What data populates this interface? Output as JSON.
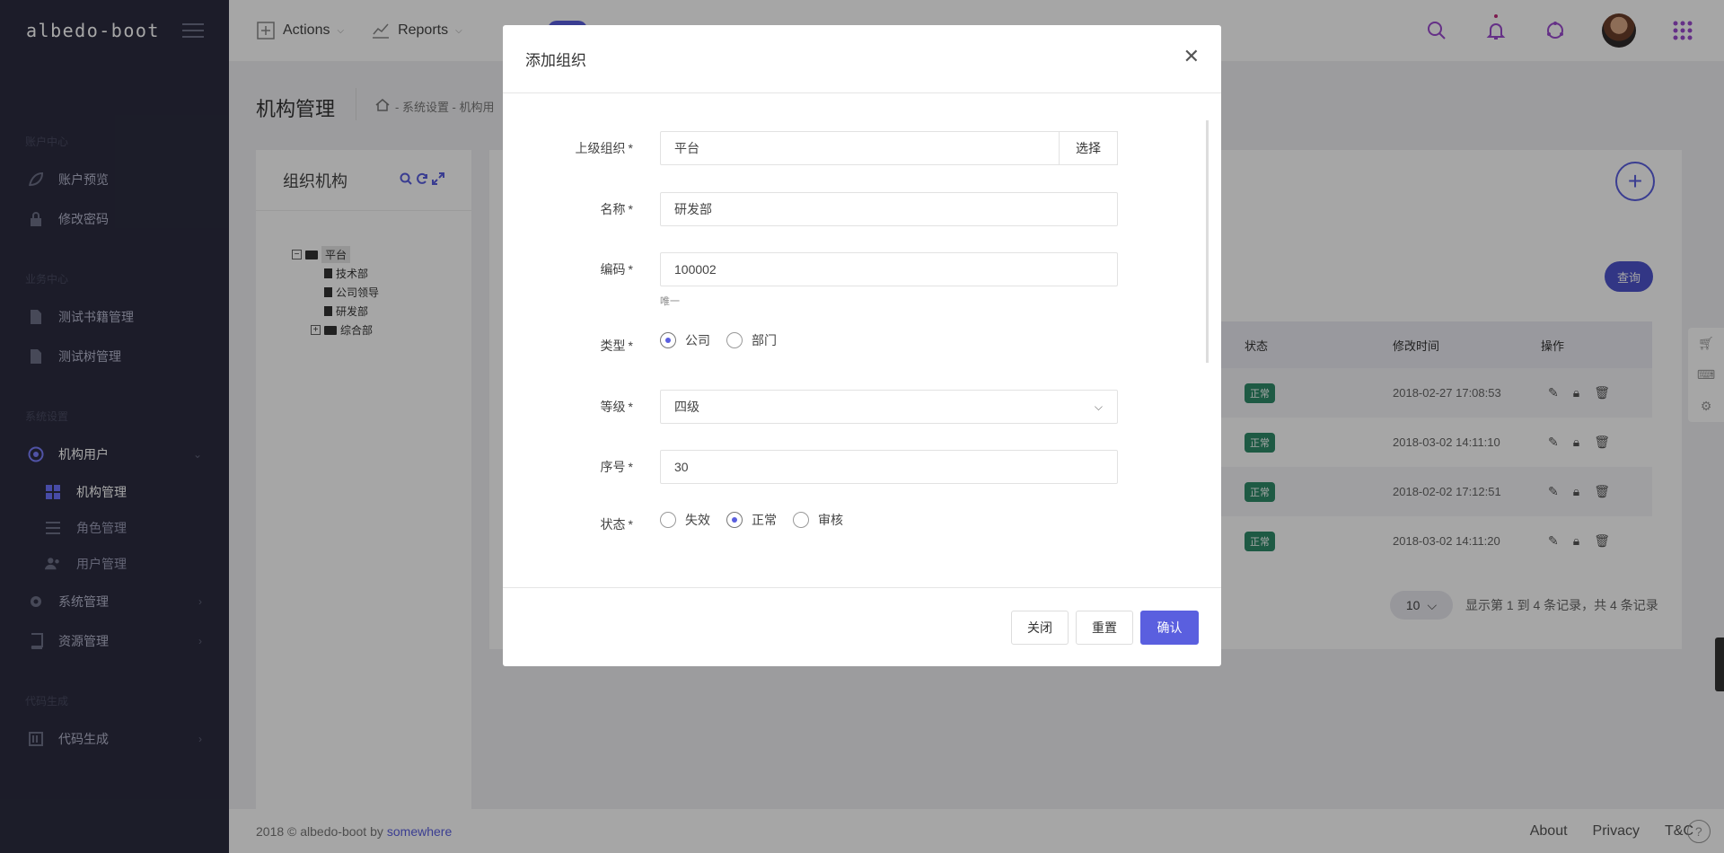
{
  "brand": "albedo-boot",
  "sidebar": {
    "sections": [
      "账户中心",
      "业务中心",
      "系统设置",
      "代码生成"
    ],
    "account_items": [
      {
        "label": "账户预览",
        "icon": "leaf-icon"
      },
      {
        "label": "修改密码",
        "icon": "lock-icon"
      }
    ],
    "business_items": [
      {
        "label": "测试书籍管理",
        "icon": "file-icon"
      },
      {
        "label": "测试树管理",
        "icon": "file-icon"
      }
    ],
    "system_items": [
      {
        "label": "机构用户",
        "icon": "target-icon"
      },
      {
        "label": "系统管理",
        "icon": "gear-icon"
      },
      {
        "label": "资源管理",
        "icon": "book-icon"
      }
    ],
    "sub_items": [
      {
        "label": "机构管理",
        "icon": "grid-icon"
      },
      {
        "label": "角色管理",
        "icon": "list-icon"
      },
      {
        "label": "用户管理",
        "icon": "users-icon"
      }
    ],
    "code_items": [
      {
        "label": "代码生成",
        "icon": "code-icon"
      }
    ]
  },
  "topbar": {
    "actions_label": "Actions",
    "reports_label": "Reports"
  },
  "page": {
    "title": "机构管理",
    "breadcrumb": "- 系统设置 - 机构用"
  },
  "left_panel": {
    "title": "组织机构",
    "tree": {
      "root": "平台",
      "children": [
        "技术部",
        "公司领导",
        "研发部",
        "综合部"
      ]
    }
  },
  "right_panel": {
    "query_label": "查询",
    "columns": [
      "状态",
      "修改时间",
      "操作"
    ],
    "rows": [
      {
        "status": "正常",
        "time": "2018-02-27 17:08:53"
      },
      {
        "status": "正常",
        "time": "2018-03-02 14:11:10"
      },
      {
        "status": "正常",
        "time": "2018-02-02 17:12:51"
      },
      {
        "status": "正常",
        "time": "2018-03-02 14:11:20"
      }
    ],
    "page_size": "10",
    "pager_text": "显示第 1 到 4 条记录，共 4 条记录"
  },
  "footer": {
    "copyright": "2018 © albedo-boot by",
    "author": "somewhere",
    "links": [
      "About",
      "Privacy",
      "T&C"
    ]
  },
  "modal": {
    "title": "添加组织",
    "fields": {
      "parent": {
        "label": "上级组织",
        "value": "平台",
        "button": "选择"
      },
      "name": {
        "label": "名称",
        "value": "研发部"
      },
      "code": {
        "label": "编码",
        "value": "100002",
        "help": "唯一"
      },
      "type": {
        "label": "类型",
        "options": [
          "公司",
          "部门"
        ],
        "selected": "公司"
      },
      "grade": {
        "label": "等级",
        "value": "四级"
      },
      "sort": {
        "label": "序号",
        "value": "30"
      },
      "status": {
        "label": "状态",
        "options": [
          "失效",
          "正常",
          "审核"
        ],
        "selected": "正常"
      }
    },
    "required_mark": "*",
    "buttons": {
      "close": "关闭",
      "reset": "重置",
      "confirm": "确认"
    }
  },
  "colors": {
    "accent": "#5a5fdf",
    "sidebar_bg": "#2b2c3f",
    "status_green": "#2e8b69"
  }
}
